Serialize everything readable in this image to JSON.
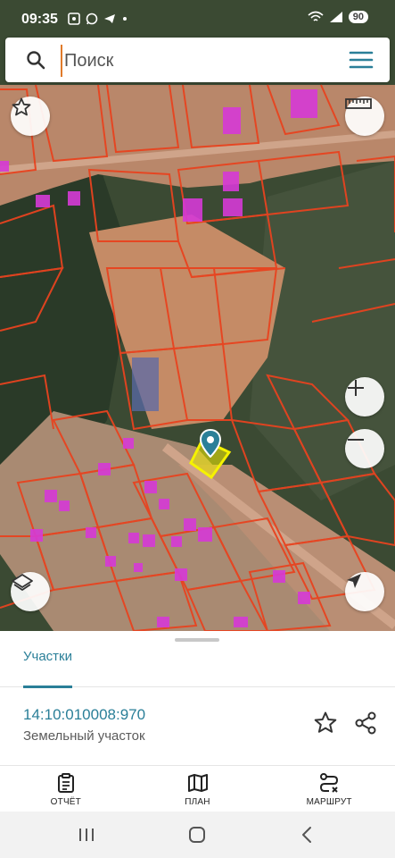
{
  "status_bar": {
    "time": "09:35",
    "battery": "90",
    "left_icons": [
      "screenshot-icon",
      "whatsapp-icon",
      "telegram-icon",
      "dot-icon"
    ],
    "right_icons": [
      "wifi-icon",
      "signal-icon",
      "battery-icon"
    ]
  },
  "search": {
    "placeholder": "Поиск",
    "value": ""
  },
  "map": {
    "buttons": [
      "favorites-star-icon",
      "ruler-icon",
      "zoom-in-icon",
      "zoom-out-icon",
      "layers-icon",
      "my-location-icon"
    ],
    "selected_marker": "location-pin-icon",
    "colors": {
      "parcel_outline": "#e8431f",
      "building": "#d63ad6",
      "selected_parcel": "#f5f200",
      "accent": "#2a7f98"
    }
  },
  "sheet": {
    "tab_label": "Участки",
    "parcel": {
      "number": "14:10:010008:970",
      "type": "Земельный участок"
    }
  },
  "bottom_nav": [
    {
      "label": "ОТЧЁТ",
      "icon": "report-clipboard-icon"
    },
    {
      "label": "ПЛАН",
      "icon": "map-plan-icon"
    },
    {
      "label": "МАРШРУТ",
      "icon": "route-icon"
    }
  ],
  "system_nav": [
    "recents-icon",
    "home-icon",
    "back-icon"
  ]
}
